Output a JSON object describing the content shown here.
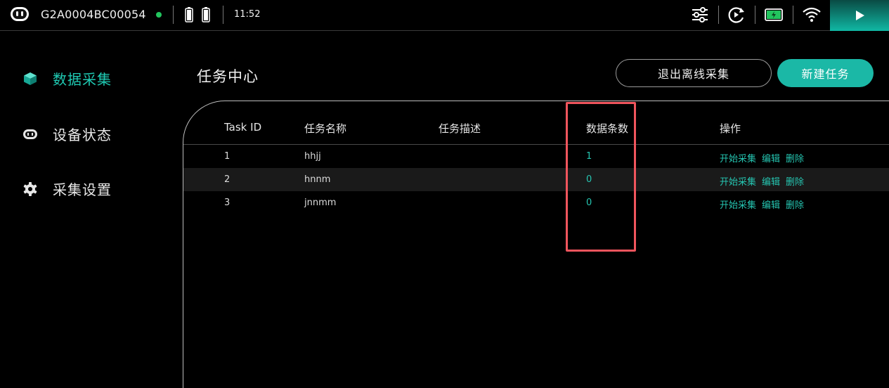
{
  "status_bar": {
    "device_id": "G2A0004BC00054",
    "time": "11:52",
    "online_color": "#22c55e"
  },
  "sidebar": {
    "items": [
      {
        "label": "数据采集",
        "icon": "cube-icon",
        "active": true
      },
      {
        "label": "设备状态",
        "icon": "robot-icon",
        "active": false
      },
      {
        "label": "采集设置",
        "icon": "gear-icon",
        "active": false
      }
    ]
  },
  "header": {
    "title": "任务中心",
    "exit_offline_label": "退出离线采集",
    "new_task_label": "新建任务"
  },
  "table": {
    "columns": [
      "Task ID",
      "任务名称",
      "任务描述",
      "数据条数",
      "操作"
    ],
    "rows": [
      {
        "id": "1",
        "name": "hhjj",
        "desc": "",
        "count": "1"
      },
      {
        "id": "2",
        "name": "hnnm",
        "desc": "",
        "count": "0"
      },
      {
        "id": "3",
        "name": "jnnmm",
        "desc": "",
        "count": "0"
      }
    ],
    "actions": [
      "开始采集",
      "编辑",
      "删除"
    ]
  },
  "colors": {
    "accent": "#1bb8a6",
    "highlight": "#f0555d"
  }
}
